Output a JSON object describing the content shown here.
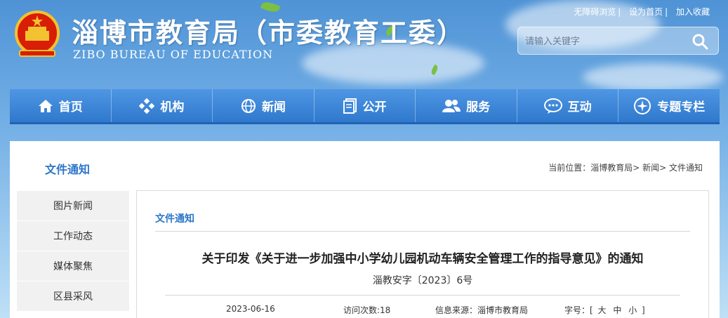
{
  "header": {
    "title": "淄博市教育局（市委教育工委）",
    "subtitle": "ZIBO BUREAU OF EDUCATION",
    "links": [
      "无障碍浏览",
      "设为首页",
      "加入收藏"
    ],
    "search_placeholder": "请输入关键字",
    "logo_icon": "national-emblem-icon"
  },
  "nav": {
    "items": [
      {
        "label": "首页",
        "icon": "home-icon"
      },
      {
        "label": "机构",
        "icon": "org-icon"
      },
      {
        "label": "新闻",
        "icon": "globe-icon"
      },
      {
        "label": "公开",
        "icon": "document-icon"
      },
      {
        "label": "服务",
        "icon": "users-icon"
      },
      {
        "label": "互动",
        "icon": "chat-icon"
      },
      {
        "label": "专题专栏",
        "icon": "compass-icon"
      }
    ]
  },
  "page": {
    "section_title": "文件通知",
    "breadcrumb": "当前位置：淄博教育局> 新闻> 文件通知"
  },
  "sidebar": {
    "items": [
      "图片新闻",
      "工作动态",
      "媒体聚焦",
      "区县采风"
    ]
  },
  "article": {
    "category": "文件通知",
    "title": "关于印发《关于进一步加强中小学幼儿园机动车辆安全管理工作的指导意见》的通知",
    "doc_number": "淄教安字〔2023〕6号",
    "date": "2023-06-16",
    "visits": "访问次数:18",
    "source": "信息来源：淄博市教育局",
    "font_size_label": "字号：[",
    "font_sizes": [
      "大",
      "中",
      "小"
    ],
    "font_size_end": "]"
  },
  "colors": {
    "accent": "#2d76c9",
    "nav": "#3a86dc"
  }
}
